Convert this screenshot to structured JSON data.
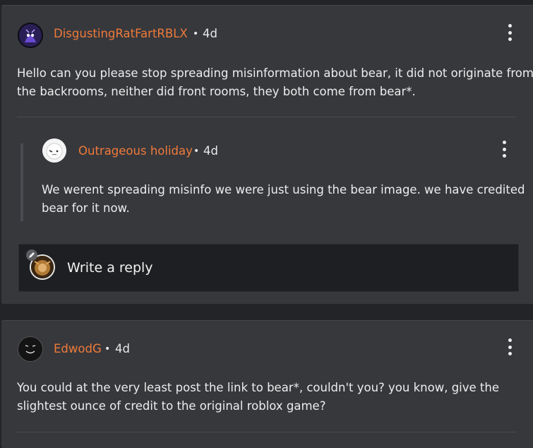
{
  "comments": [
    {
      "username": "DisgustingRatFartRBLX",
      "separator": "•",
      "time": "4d",
      "body_lines": [
        "Hello can you please stop spreading misinformation about bear, it did not originate from",
        "the backrooms, neither did front rooms, they both come from bear*."
      ],
      "reply": {
        "username": "Outrageous holiday",
        "separator": "•",
        "time": "4d",
        "body_lines": [
          "We werent spreading misinfo we were just using the bear image. we have credited",
          "bear for it now."
        ]
      },
      "write_reply_label": "Write a reply"
    },
    {
      "username": "EdwodG",
      "separator": "•",
      "time": "4d",
      "body_lines": [
        "You could at the very least post the link to bear*, couldn't you? you know, give the",
        "slightest ounce of credit to the original roblox game?"
      ]
    }
  ],
  "colors": {
    "background": "#232427",
    "card": "#37383c",
    "username": "#ef7a3a",
    "reply_box": "#1e1f22"
  },
  "icons": {
    "menu": "kebab-menu-icon",
    "edit": "pencil-icon"
  }
}
